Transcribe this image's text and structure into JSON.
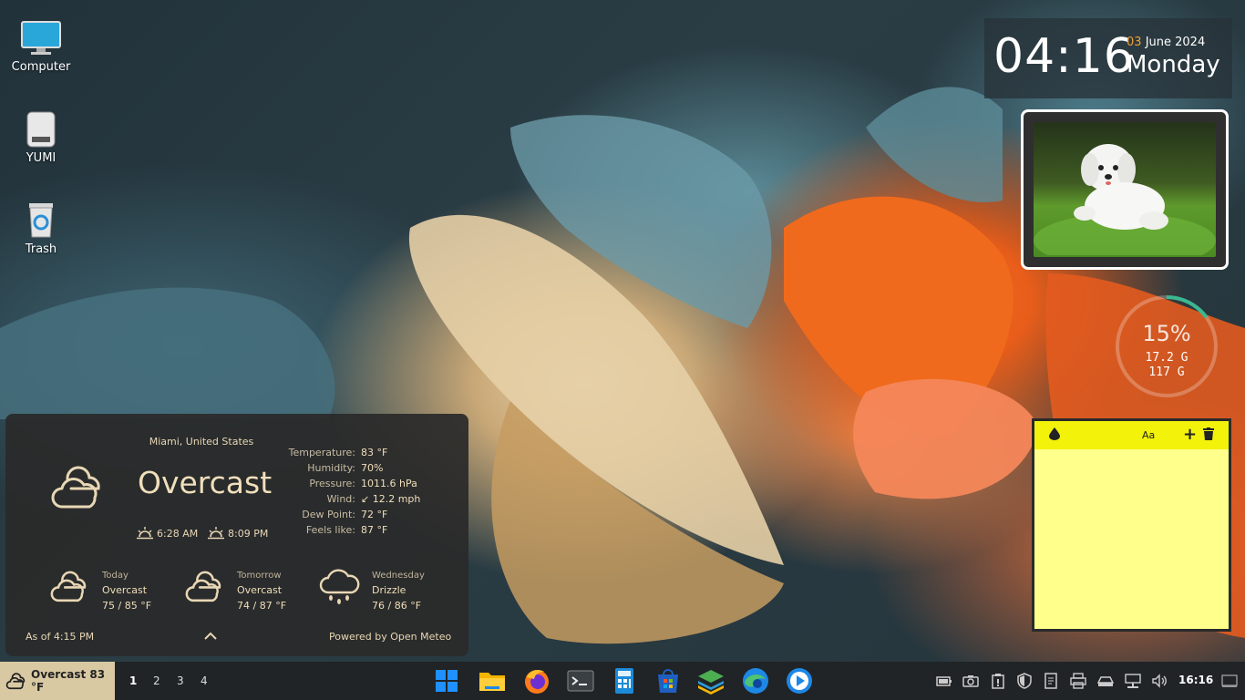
{
  "desktop": {
    "icons": [
      {
        "label": "Computer"
      },
      {
        "label": "YUMI"
      },
      {
        "label": "Trash"
      }
    ]
  },
  "clock": {
    "time": "04:16",
    "day_num": "03",
    "month_year": "June 2024",
    "weekday": "Monday"
  },
  "disk": {
    "percent": "15%",
    "percent_value": 15,
    "used": "17.2 G",
    "total": "117 G"
  },
  "weather": {
    "location": "Miami, United States",
    "condition": "Overcast",
    "sunrise": "6:28 AM",
    "sunset": "8:09 PM",
    "details": [
      {
        "label": "Temperature:",
        "value": "83 °F"
      },
      {
        "label": "Humidity:",
        "value": "70%"
      },
      {
        "label": "Pressure:",
        "value": "1011.6 hPa"
      },
      {
        "label": "Wind:",
        "value": "↙ 12.2 mph"
      },
      {
        "label": "Dew Point:",
        "value": "72 °F"
      },
      {
        "label": "Feels like:",
        "value": "87 °F"
      }
    ],
    "forecast": [
      {
        "day": "Today",
        "condition": "Overcast",
        "temps": "75 / 85 °F",
        "icon": "cloud-icon"
      },
      {
        "day": "Tomorrow",
        "condition": "Overcast",
        "temps": "74 / 87 °F",
        "icon": "cloud-icon"
      },
      {
        "day": "Wednesday",
        "condition": "Drizzle",
        "temps": "76 / 86 °F",
        "icon": "rain-cloud-icon"
      }
    ],
    "as_of": "As of 4:15 PM",
    "powered_by": "Powered by Open Meteo"
  },
  "taskbar": {
    "weather_label": "Overcast 83 °F",
    "workspaces": [
      "1",
      "2",
      "3",
      "4"
    ],
    "apps": [
      "start-icon",
      "file-manager-icon",
      "firefox-icon",
      "terminal-icon",
      "calculator-icon",
      "store-icon",
      "layers-icon",
      "edge-icon",
      "media-player-icon"
    ],
    "tray": [
      "battery-icon",
      "camera-icon",
      "clipboard-icon",
      "shield-icon",
      "notes-icon",
      "printer-icon",
      "drive-icon",
      "network-icon",
      "volume-icon"
    ],
    "time": "16:16"
  },
  "colors": {
    "accent_orange": "#f0a030",
    "note_yellow": "#ffff8c",
    "note_bar": "#f2f20a",
    "disk_ring": "#3ab890",
    "weather_text": "#e8d7b5"
  }
}
